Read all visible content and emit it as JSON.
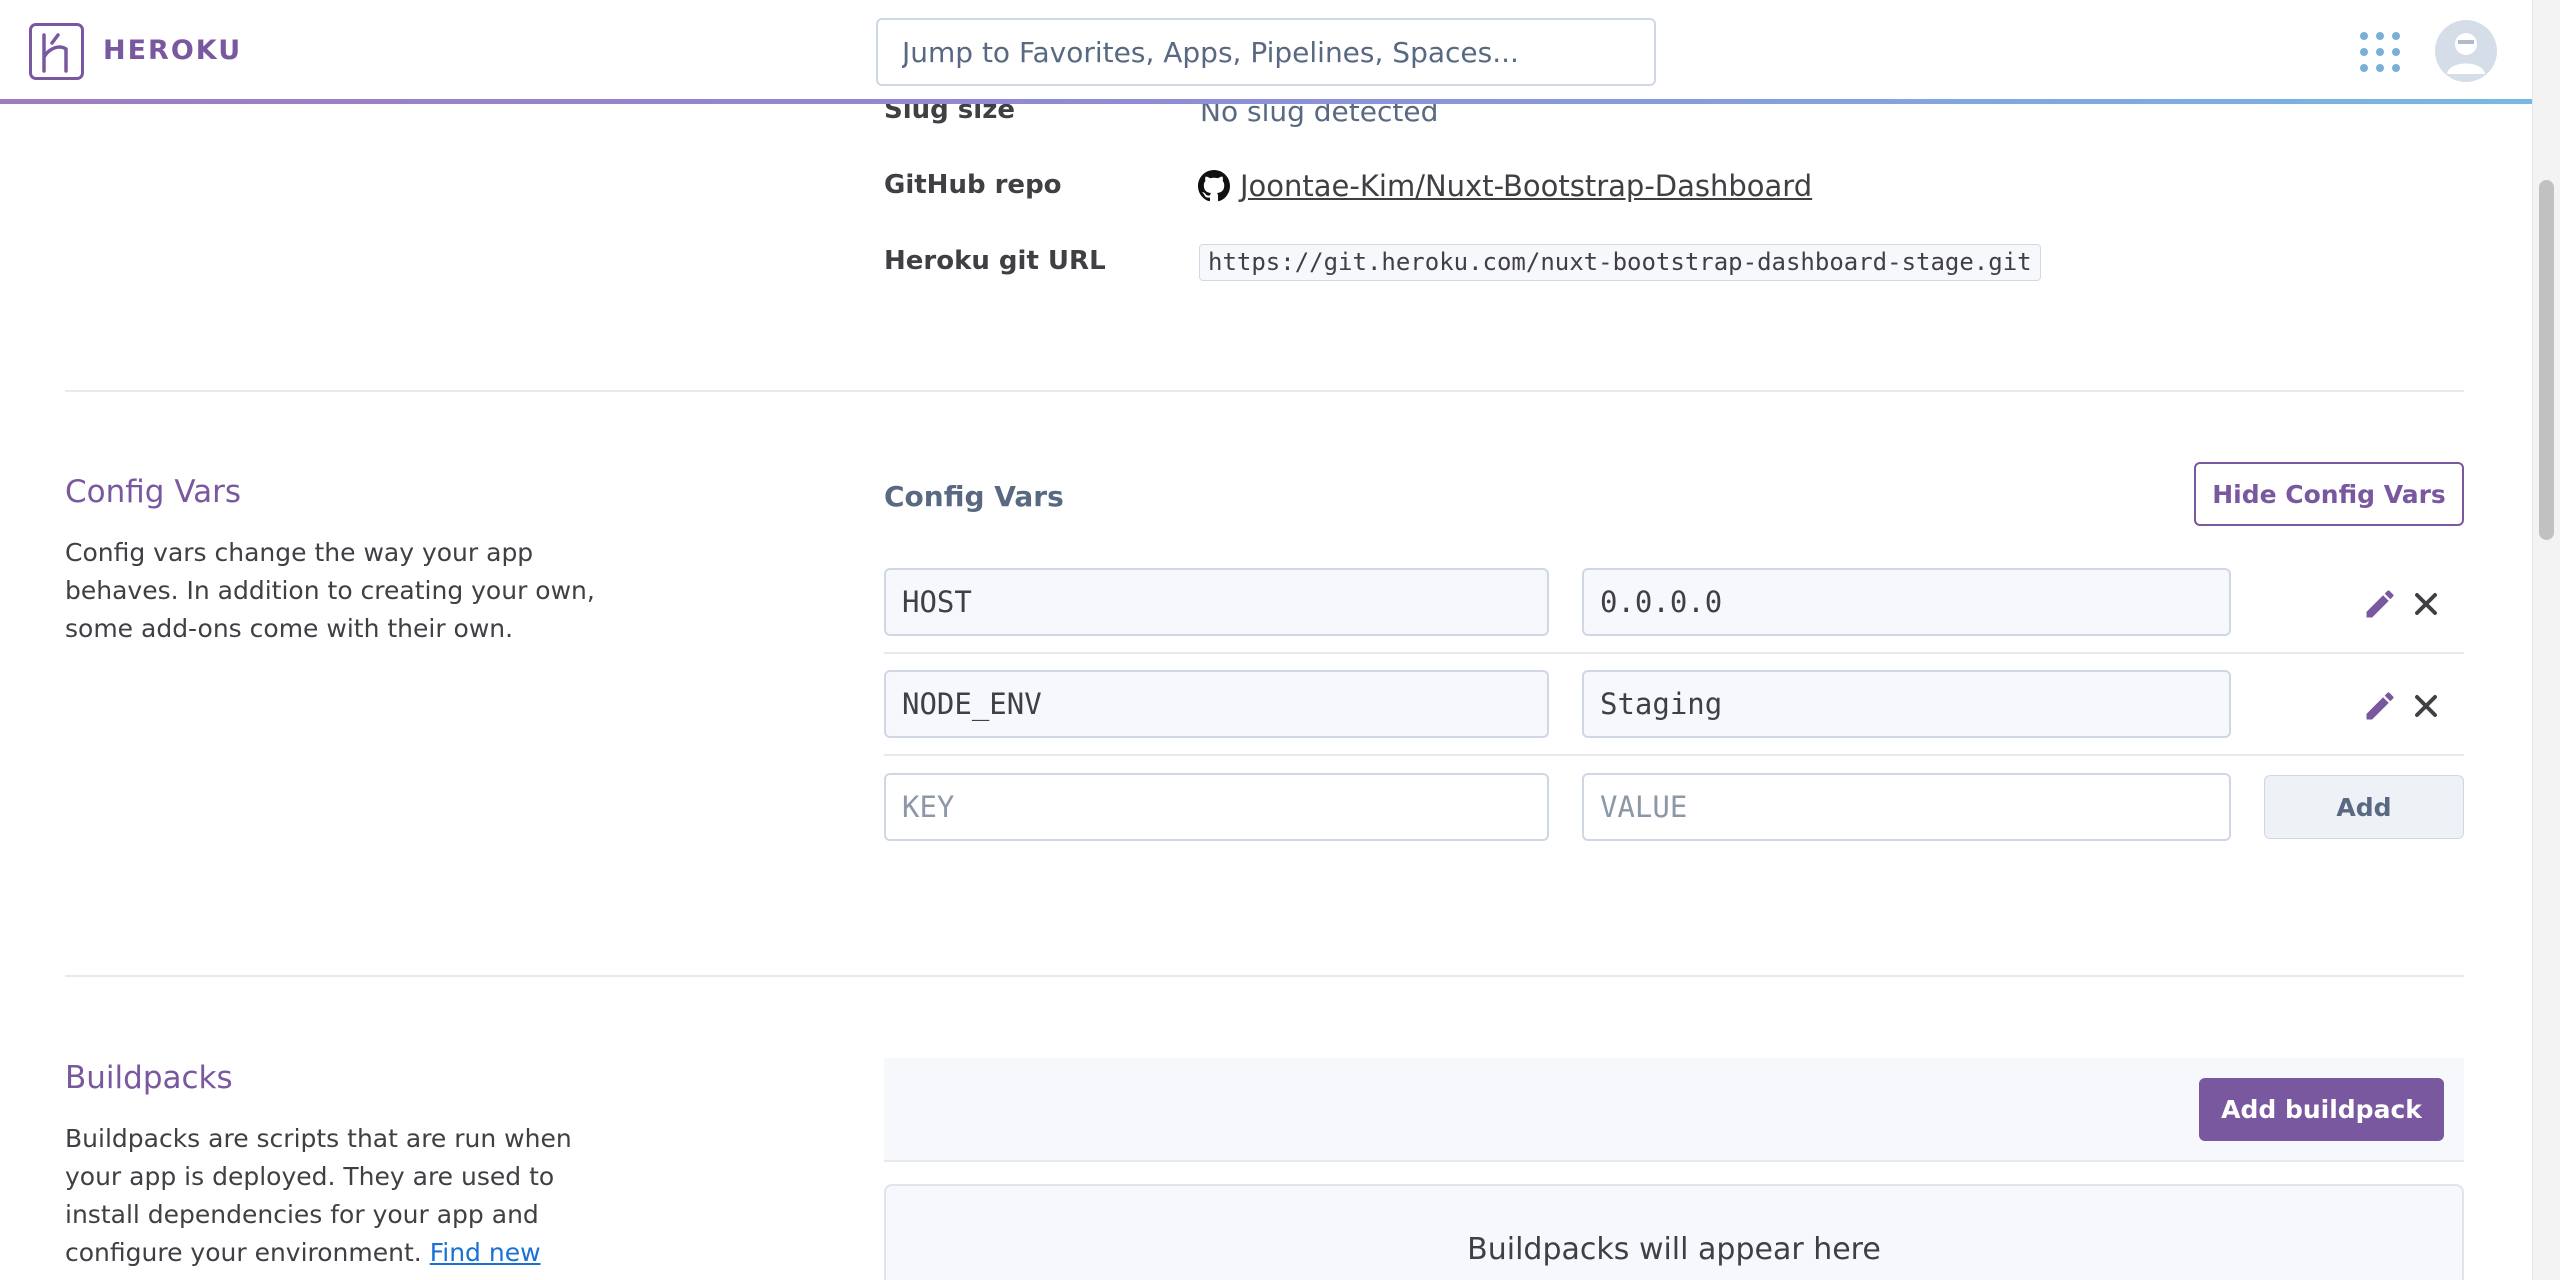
{
  "header": {
    "brand": "HEROKU",
    "search_placeholder": "Jump to Favorites, Apps, Pipelines, Spaces..."
  },
  "app_info": {
    "slug_size_label": "Slug size",
    "slug_size_value": "No slug detected",
    "github_label": "GitHub repo",
    "github_repo": "Joontae-Kim/Nuxt-Bootstrap-Dashboard",
    "git_url_label": "Heroku git URL",
    "git_url": "https://git.heroku.com/nuxt-bootstrap-dashboard-stage.git"
  },
  "config_vars": {
    "section_title": "Config Vars",
    "description": "Config vars change the way your app behaves. In addition to creating your own, some add-ons come with their own.",
    "panel_title": "Config Vars",
    "hide_button": "Hide Config Vars",
    "vars": [
      {
        "key": "HOST",
        "value": "0.0.0.0"
      },
      {
        "key": "NODE_ENV",
        "value": "Staging"
      }
    ],
    "new_key_placeholder": "KEY",
    "new_value_placeholder": "VALUE",
    "add_button": "Add"
  },
  "buildpacks": {
    "section_title": "Buildpacks",
    "description": "Buildpacks are scripts that are run when your app is deployed. They are used to install dependencies for your app and configure your environment.",
    "find_link": "Find new buildpacks on",
    "add_button": "Add buildpack",
    "empty_text": "Buildpacks will appear here"
  },
  "colors": {
    "accent": "#79589f",
    "link": "#1a71d5"
  }
}
